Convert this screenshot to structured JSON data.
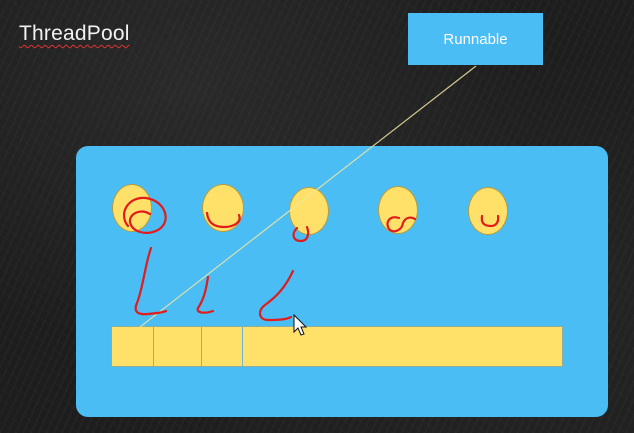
{
  "title": "ThreadPool",
  "runnable_label": "Runnable",
  "thread_count": 5,
  "queue_slots_filled": 3,
  "colors": {
    "pool": "#4bbdf5",
    "thread": "#ffe16a",
    "ink": "#e01c1c",
    "connector": "#f0e6a0"
  },
  "icons": [
    "cursor-arrow-icon"
  ]
}
